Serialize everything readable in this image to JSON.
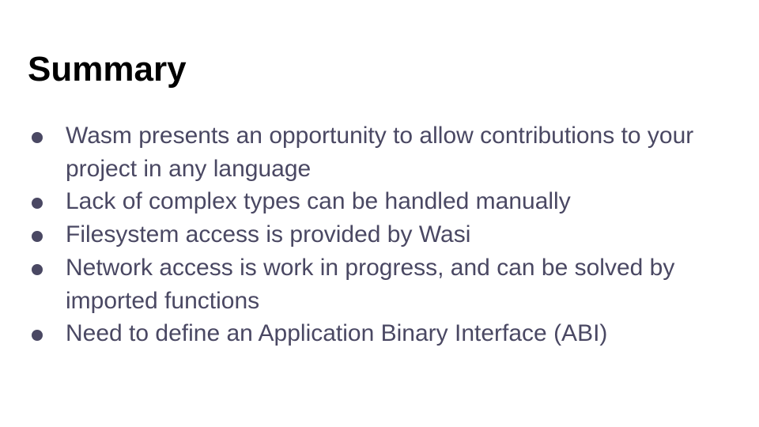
{
  "slide": {
    "title": "Summary",
    "bullets": [
      "Wasm presents an opportunity to allow contributions to your project in any language",
      "Lack of complex types can be handled manually",
      "Filesystem access is provided by Wasi",
      "Network access is work in progress, and can be solved by imported functions",
      "Need to define an Application Binary Interface (ABI)"
    ]
  },
  "colors": {
    "title": "#000000",
    "body_text": "#4a4863",
    "background": "#ffffff"
  }
}
